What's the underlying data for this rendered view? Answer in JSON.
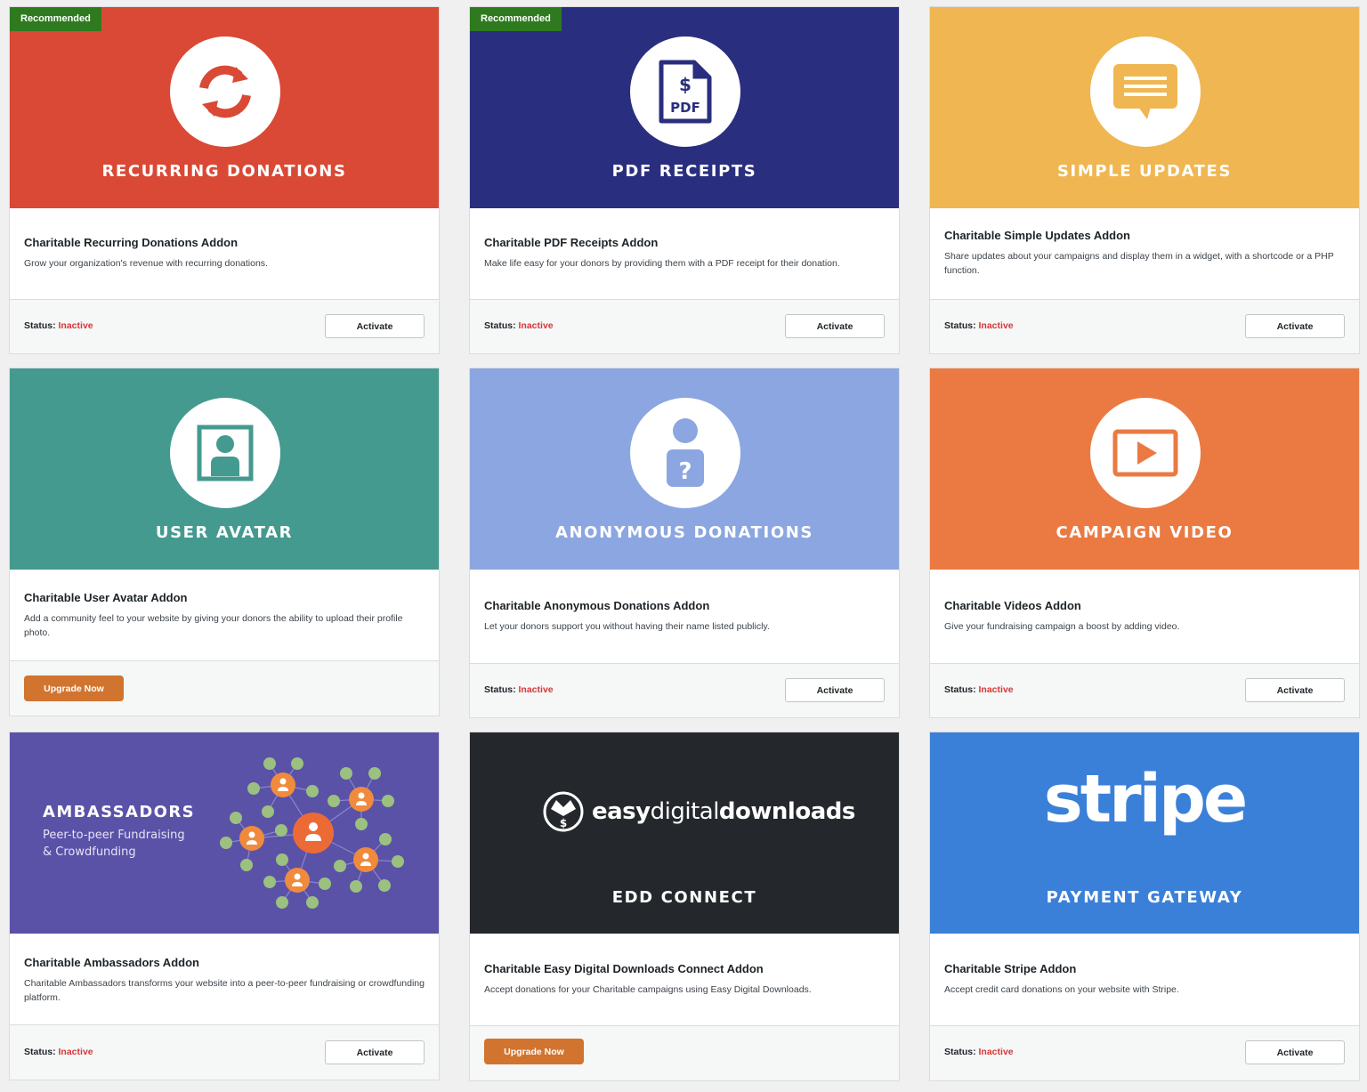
{
  "ribbon": "Recommended",
  "status_label": "Status:",
  "cards": [
    {
      "banner": "RECURRING DONATIONS",
      "name": "Charitable Recurring Donations Addon",
      "desc": "Grow your organization's revenue with recurring donations.",
      "status": "Inactive",
      "button": "Activate",
      "color": "#d94935",
      "icon": "refresh-icon"
    },
    {
      "banner": "PDF RECEIPTS",
      "name": "Charitable PDF Receipts Addon",
      "desc": "Make life easy for your donors by providing them with a PDF receipt for their donation.",
      "status": "Inactive",
      "button": "Activate",
      "color": "#2a2e7e",
      "icon": "pdf-file-icon",
      "icon_text_1": "$",
      "icon_text_2": "PDF"
    },
    {
      "banner": "SIMPLE UPDATES",
      "name": "Charitable Simple Updates Addon",
      "desc": "Share updates about your campaigns and display them in a widget, with a shortcode or a PHP function.",
      "status": "Inactive",
      "button": "Activate",
      "color": "#efb651",
      "icon": "message-icon"
    },
    {
      "banner": "USER AVATAR",
      "name": "Charitable User Avatar Addon",
      "desc": "Add a community feel to your website by giving your donors the ability to upload their profile photo.",
      "button": "Upgrade Now",
      "color": "#449a8f",
      "icon": "avatar-icon"
    },
    {
      "banner": "ANONYMOUS DONATIONS",
      "name": "Charitable Anonymous Donations Addon",
      "desc": "Let your donors support you without having their name listed publicly.",
      "status": "Inactive",
      "button": "Activate",
      "color": "#8ba6e0",
      "icon": "anonymous-user-icon",
      "icon_text_1": "?"
    },
    {
      "banner": "CAMPAIGN VIDEO",
      "name": "Charitable Videos Addon",
      "desc": "Give your fundraising campaign a boost by adding video.",
      "status": "Inactive",
      "button": "Activate",
      "color": "#ea7a42",
      "icon": "video-icon"
    },
    {
      "banner": "AMBASSADORS",
      "banner_sub_1": "Peer-to-peer Fundraising",
      "banner_sub_2": "& Crowdfunding",
      "name": "Charitable Ambassadors Addon",
      "desc": "Charitable Ambassadors transforms your website into a peer-to-peer fundraising or crowdfunding platform.",
      "status": "Inactive",
      "button": "Activate",
      "color": "#5a52a7",
      "icon": "network-icon"
    },
    {
      "banner": "EDD CONNECT",
      "logo_text_1": "easy",
      "logo_text_2": "digital",
      "logo_text_3": "downloads",
      "logo_glyph": "$",
      "name": "Charitable Easy Digital Downloads Connect Addon",
      "desc": "Accept donations for your Charitable campaigns using Easy Digital Downloads.",
      "button": "Upgrade Now",
      "color": "#24272b",
      "icon": "edd-logo-icon"
    },
    {
      "banner": "PAYMENT GATEWAY",
      "logo_text": "stripe",
      "name": "Charitable Stripe Addon",
      "desc": "Accept credit card donations on your website with Stripe.",
      "status": "Inactive",
      "button": "Activate",
      "color": "#3a80d8",
      "icon": "stripe-logo"
    }
  ]
}
